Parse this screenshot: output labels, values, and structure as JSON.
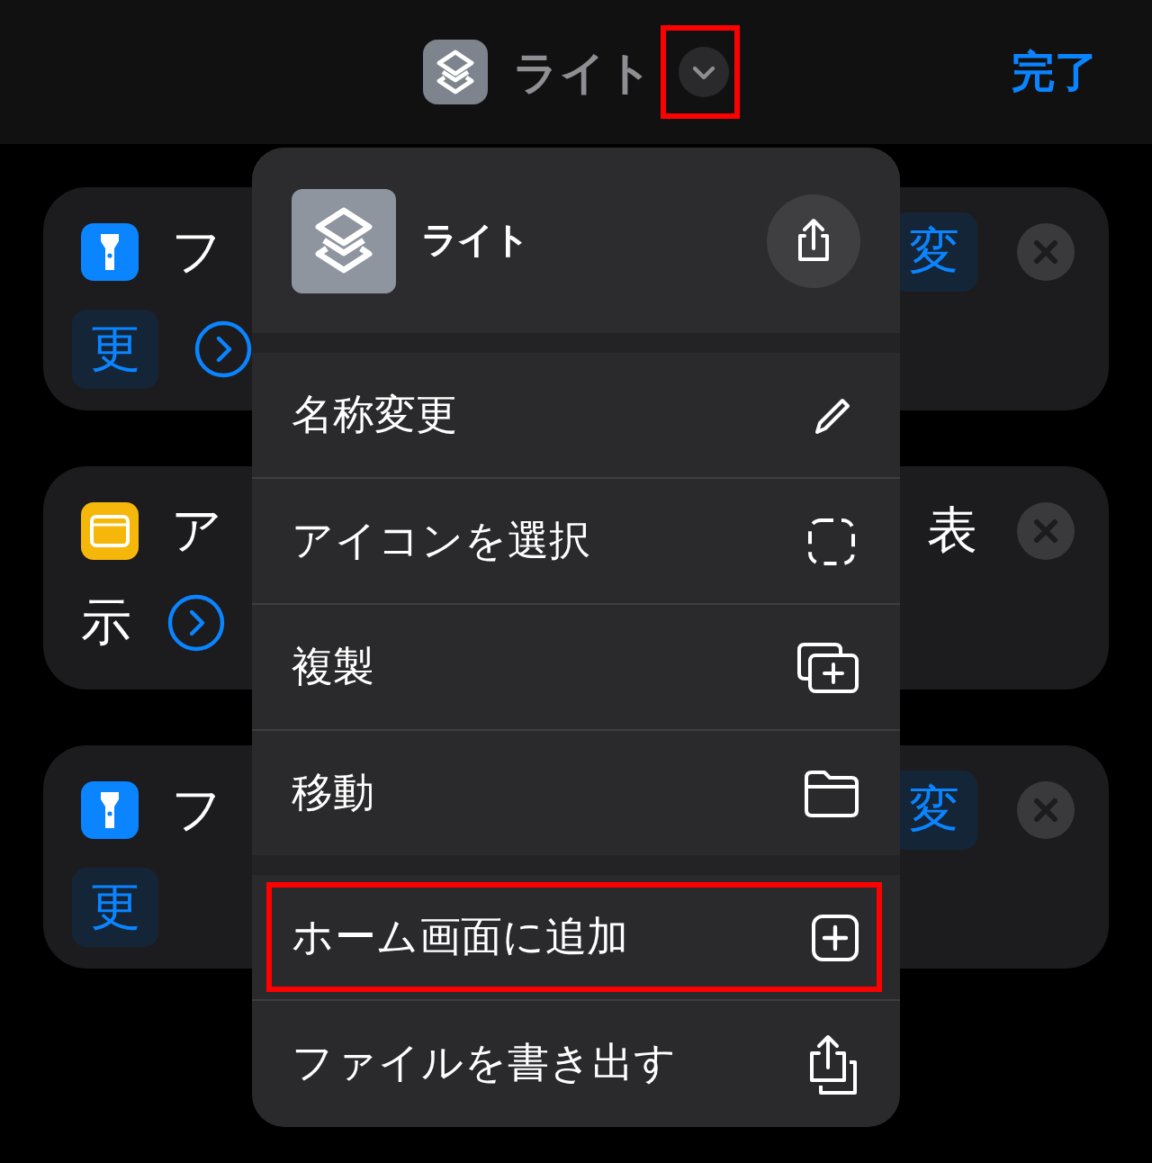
{
  "header": {
    "title": "ライト",
    "chevron_highlighted": true,
    "done": "完了"
  },
  "cards": [
    {
      "kind": "token",
      "color": "#0a84ff",
      "title": "フ",
      "right_text": "変",
      "second_text": "更",
      "arrow": true
    },
    {
      "kind": "text",
      "color": "#f5b70a",
      "title": "ア",
      "right_text": "表",
      "second_text": "示",
      "arrow": true
    },
    {
      "kind": "token",
      "color": "#0a84ff",
      "title": "フ",
      "right_text": "変",
      "second_text": "更",
      "arrow": false
    }
  ],
  "menu": {
    "title": "ライト",
    "groups": [
      [
        {
          "label": "名称変更",
          "kind": "rename",
          "highlighted": false
        },
        {
          "label": "アイコンを選択",
          "kind": "icon",
          "highlighted": false
        },
        {
          "label": "複製",
          "kind": "duplicate",
          "highlighted": false
        },
        {
          "label": "移動",
          "kind": "move",
          "highlighted": false
        }
      ],
      [
        {
          "label": "ホーム画面に追加",
          "kind": "add",
          "highlighted": true
        },
        {
          "label": "ファイルを書き出す",
          "kind": "export",
          "highlighted": false
        }
      ]
    ]
  }
}
